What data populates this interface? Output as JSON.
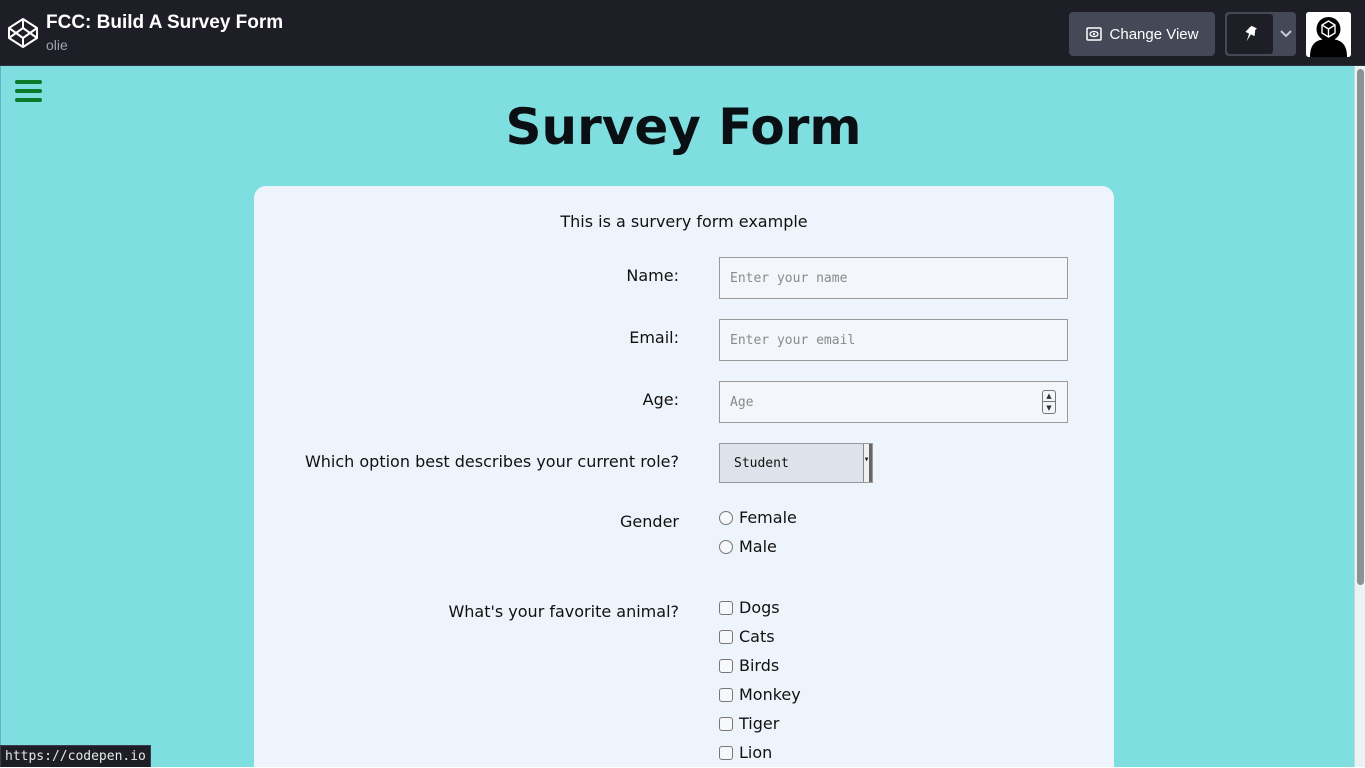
{
  "topbar": {
    "pen_title": "FCC: Build A Survey Form",
    "author": "olie",
    "change_view_label": "Change View",
    "logo_icon": "codepen-logo-icon",
    "pin_icon": "pin-icon",
    "caret_icon": "chevron-down-icon"
  },
  "preview": {
    "background_color": "#7fdfe0",
    "title": "Survey Form",
    "description": "This is a survery form example",
    "fields": {
      "name_label": "Name:",
      "name_placeholder": "Enter your name",
      "email_label": "Email:",
      "email_placeholder": "Enter your email",
      "age_label": "Age:",
      "age_placeholder": "Age",
      "role_label": "Which option best describes your current role?",
      "role_value": "Student"
    },
    "gender": {
      "label": "Gender",
      "options": [
        "Female",
        "Male"
      ]
    },
    "animals": {
      "label": "What's your favorite animal?",
      "options": [
        "Dogs",
        "Cats",
        "Birds",
        "Monkey",
        "Tiger",
        "Lion"
      ]
    }
  },
  "status_bar": {
    "url": "https://codepen.io"
  }
}
